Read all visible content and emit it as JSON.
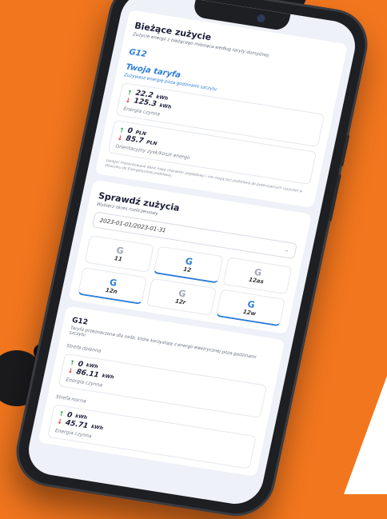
{
  "current": {
    "title": "Bieżące zużycie",
    "subtitle": "Zużycie energii z bieżącego miesiąca według taryfy domyślnej",
    "tariff_code": "G12",
    "tariff_title": "Twoja taryfa",
    "tariff_sub": "Zużywasz energię poza godzinami szczytu",
    "energy": {
      "up": "22.2",
      "up_unit": "kWh",
      "down": "125.3",
      "down_unit": "kWh",
      "label": "Energia czynna"
    },
    "cost": {
      "up": "0",
      "up_unit": "PLN",
      "down": "85.7",
      "down_unit": "PLN",
      "label": "Orientacyjny zysk/koszt energii"
    },
    "note": "Uwaga! Prezentowane dane mają charakter poglądowy i nie mogą być podstawą do potencjalnych roszczeń w stosunku do Energetycznej podstawy."
  },
  "check": {
    "title": "Sprawdź zużycia",
    "period_label": "Wybierz okres rozliczeniowy",
    "period_value": "2023-01-01/2023-01-31",
    "tiles": [
      {
        "icon": "G",
        "label": "11",
        "active": false
      },
      {
        "icon": "G",
        "label": "12",
        "active": true
      },
      {
        "icon": "G",
        "label": "12as",
        "active": false
      },
      {
        "icon": "G",
        "label": "12n",
        "active": true
      },
      {
        "icon": "G",
        "label": "12r",
        "active": false
      },
      {
        "icon": "G",
        "label": "12w",
        "active": true
      }
    ]
  },
  "detail": {
    "title": "G12",
    "desc": "Taryfa przeznaczona dla osób, które korzystają z energii elektrycznej poza godzinami szczytu",
    "zone_day": "Strefa dzienna",
    "day": {
      "up": "0",
      "up_unit": "kWh",
      "down": "86.11",
      "down_unit": "kWh",
      "label": "Energia czynna"
    },
    "zone_night": "Strefa nocna",
    "night": {
      "up": "0",
      "up_unit": "kWh",
      "down": "45.71",
      "down_unit": "kWh",
      "label": "Energia czynna"
    }
  }
}
